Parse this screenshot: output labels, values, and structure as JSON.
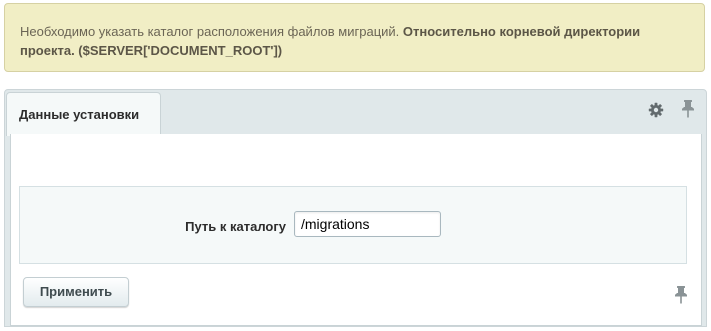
{
  "notice": {
    "text_normal": "Необходимо указать каталог расположения файлов миграций. ",
    "text_bold": "Относительно корневой директории проекта. ($SERVER['DOCUMENT_ROOT'])"
  },
  "tabs": [
    {
      "label": "Данные установки",
      "active": true
    }
  ],
  "toolbar": {
    "settings_icon": "gear-icon",
    "pin_icon": "pin-icon"
  },
  "form": {
    "path_label": "Путь к каталогу",
    "path_value": "/migrations"
  },
  "actions": {
    "apply_label": "Применить"
  },
  "colors": {
    "notice_bg": "#f1eec5",
    "panel_bg": "#e0e8ea",
    "form_bg": "#f5f9f9"
  }
}
